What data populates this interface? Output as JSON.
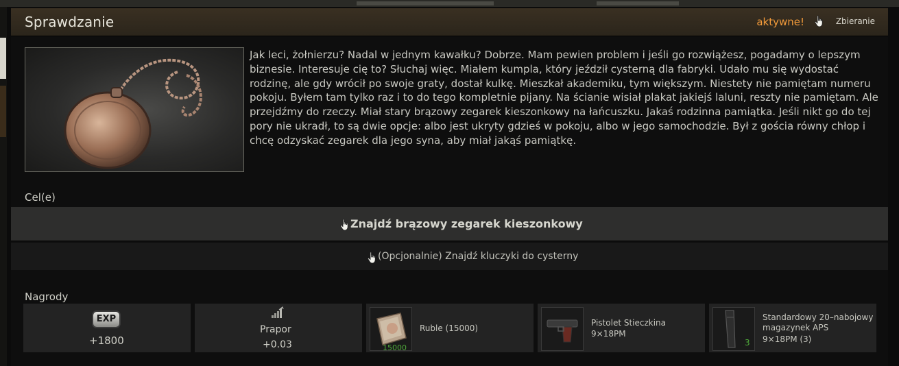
{
  "header": {
    "title": "Sprawdzanie",
    "status": "aktywne!",
    "mode_label": "Zbieranie"
  },
  "quest": {
    "image_subject": "pocket-watch",
    "description": "Jak leci, żołnierzu? Nadal w jednym kawałku? Dobrze. Mam pewien problem i jeśli go rozwiążesz, pogadamy o lepszym biznesie. Interesuje cię to? Słuchaj więc. Miałem kumpla, który jeździł cysterną dla fabryki. Udało mu się wydostać rodzinę, ale gdy wrócił po swoje graty, dostał kulkę. Mieszkał akademiku, tym większym. Niestety nie pamiętam numeru pokoju. Byłem tam tylko raz i to do tego kompletnie pijany. Na ścianie wisiał plakat jakiejś laluni, reszty nie pamiętam. Ale przejdźmy do rzeczy. Miał stary brązowy zegarek kieszonkowy na łańcuszku. Jakaś rodzinna pamiątka. Jeśli nikt go do tej pory nie ukradł, to są dwie opcje: albo jest ukryty gdzieś w pokoju, albo w jego samochodzie. Był z gościa równy chłop i chcę odzyskać zegarek dla jego syna, aby miał jakąś pamiątkę."
  },
  "objectives": {
    "heading": "Cel(e)",
    "items": [
      {
        "label": "Znajdź brązowy zegarek kieszonkowy"
      },
      {
        "label": "(Opcjonalnie) Znajdź kluczyki do cysterny"
      }
    ]
  },
  "rewards": {
    "heading": "Nagrody",
    "exp": {
      "badge": "EXP",
      "value": "+1800"
    },
    "rep": {
      "trader": "Prapor",
      "value": "+0.03",
      "icon": "rep-bars-icon"
    },
    "items": [
      {
        "name": "Ruble (15000)",
        "count": "15000",
        "icon": "rubles-icon"
      },
      {
        "name": "Pistolet Stieczkina",
        "ammo": "9×18PM",
        "icon": "pistol-icon"
      },
      {
        "name": "Standardowy 20–nabojowy magazynek APS",
        "ammo": "9×18PM (3)",
        "count": "3",
        "icon": "magazine-icon"
      }
    ]
  },
  "colors": {
    "accent": "#f29a3a",
    "count_green": "#4fa83a",
    "header_bg": "#3a3022"
  }
}
